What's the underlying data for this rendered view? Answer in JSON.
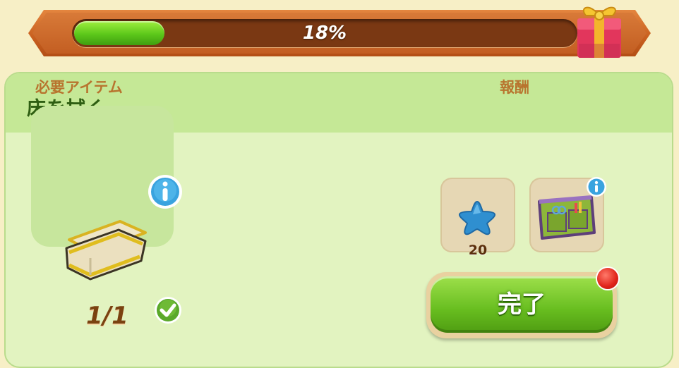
{
  "progress": {
    "label": "18%",
    "fraction": 0.18
  },
  "quest": {
    "title": "床を拭く",
    "required_label": "必要アイテム",
    "reward_label": "報酬",
    "required_item": {
      "icon": "cloth-rag-icon",
      "count": "1/1",
      "status": "complete"
    },
    "rewards": [
      {
        "icon": "star-icon",
        "count": "20"
      },
      {
        "icon": "toolbag-icon",
        "count": ""
      }
    ],
    "complete_button_label": "完了"
  },
  "colors": {
    "progress_green": "#5cc71a",
    "header_orange": "#c85f1f",
    "panel_bg": "#e2f3c0",
    "panel_header": "#c5e896",
    "title_green": "#2e5e12",
    "label_brown": "#b8742e",
    "notification_red": "#e0231a"
  }
}
